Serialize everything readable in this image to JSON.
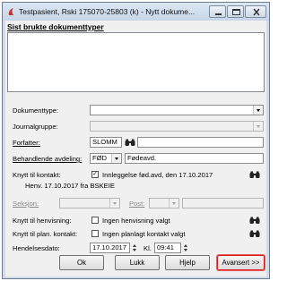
{
  "window": {
    "title": "Testpasient, Rski  175070-25803 (k) - Nytt dokume...",
    "brand_color": "#c0392b"
  },
  "section": {
    "title": "Sist brukte dokumenttyper"
  },
  "form": {
    "dokumenttype_label": "Dokumenttype:",
    "dokumenttype_value": "",
    "journalgruppe_label": "Journalgruppe:",
    "journalgruppe_value": "",
    "forfatter_label": "Forfatter:",
    "forfatter_value": "SLOMM",
    "behandlende_label": "Behandlende avdeling:",
    "behandlende_code": "FØD",
    "behandlende_name": "Fødeavd.",
    "knytt_kontakt_label": "Knytt til kontakt:",
    "knytt_kontakt_text": "Innleggelse fød.avd, den 17.10.2017",
    "knytt_kontakt_checked": "✓",
    "henvisning_info": "Henv. 17.10.2017 fra BSKEIE",
    "seksjon_label": "Seksjon:",
    "post_label": "Post:",
    "henvisning_label": "Knytt til henvisning:",
    "henvisning_text": "Ingen henvisning valgt",
    "plan_kontakt_label": "Knytt til plan. kontakt:",
    "plan_kontakt_text": "Ingen planlagt kontakt valgt",
    "hendelsesdato_label": "Hendelsesdato:",
    "hendelsesdato_value": "17.10.2017",
    "kl_label": "Kl.",
    "kl_value": "09:41"
  },
  "buttons": {
    "ok": "Ok",
    "lukk": "Lukk",
    "hjelp": "Hjelp",
    "avansert": "Avansert >>"
  },
  "icons": {
    "binoculars": "binoculars-icon",
    "app": "app-icon"
  }
}
